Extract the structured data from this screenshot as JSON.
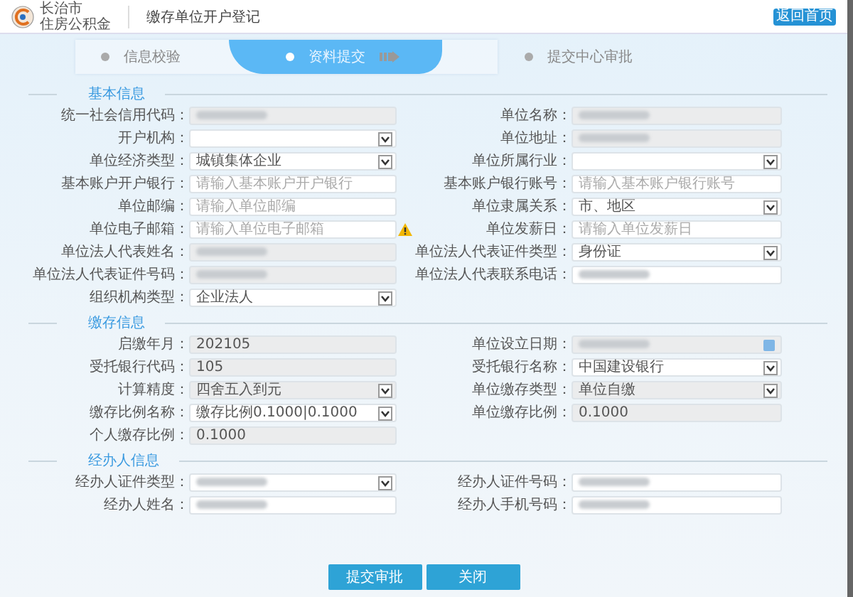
{
  "header": {
    "city": "长治市",
    "org": "住房公积金",
    "title": "缴存单位开户登记",
    "home_button": "返回首页"
  },
  "steps": [
    {
      "label": "信息校验",
      "selected": false
    },
    {
      "label": "资料提交",
      "selected": true
    },
    {
      "label": "提交中心审批",
      "selected": false
    }
  ],
  "sections": [
    {
      "title": "基本信息",
      "rows": [
        {
          "left": {
            "label": "统一社会信用代码：",
            "kind": "readonly",
            "redacted": true
          },
          "right": {
            "label": "单位名称：",
            "kind": "readonly",
            "redacted": true
          }
        },
        {
          "left": {
            "label": "开户机构：",
            "kind": "select"
          },
          "right": {
            "label": "单位地址：",
            "kind": "readonly",
            "redacted": true
          }
        },
        {
          "left": {
            "label": "单位经济类型：",
            "kind": "select",
            "value": "城镇集体企业"
          },
          "right": {
            "label": "单位所属行业：",
            "kind": "select"
          }
        },
        {
          "left": {
            "label": "基本账户开户银行：",
            "kind": "input",
            "placeholder": "请输入基本账户开户银行"
          },
          "right": {
            "label": "基本账户银行账号：",
            "kind": "input",
            "placeholder": "请输入基本账户银行账号"
          }
        },
        {
          "left": {
            "label": "单位邮编：",
            "kind": "input",
            "placeholder": "请输入单位邮编"
          },
          "right": {
            "label": "单位隶属关系：",
            "kind": "select",
            "value": "市、地区"
          }
        },
        {
          "left": {
            "label": "单位电子邮箱：",
            "kind": "input",
            "placeholder": "请输入单位电子邮箱",
            "warning": true
          },
          "right": {
            "label": "单位发薪日：",
            "kind": "input",
            "placeholder": "请输入单位发薪日"
          }
        },
        {
          "left": {
            "label": "单位法人代表姓名：",
            "kind": "readonly",
            "redacted": true
          },
          "right": {
            "label": "单位法人代表证件类型：",
            "kind": "select",
            "value": "身份证"
          }
        },
        {
          "left": {
            "label": "单位法人代表证件号码：",
            "kind": "readonly",
            "redacted": true
          },
          "right": {
            "label": "单位法人代表联系电话：",
            "kind": "input",
            "redacted": true
          }
        },
        {
          "left": {
            "label": "组织机构类型：",
            "kind": "select",
            "value": "企业法人"
          }
        }
      ]
    },
    {
      "title": "缴存信息",
      "rows": [
        {
          "left": {
            "label": "启缴年月：",
            "kind": "readonly",
            "value": "202105"
          },
          "right": {
            "label": "单位设立日期：",
            "kind": "date",
            "redacted": true
          }
        },
        {
          "left": {
            "label": "受托银行代码：",
            "kind": "readonly",
            "value": "105"
          },
          "right": {
            "label": "受托银行名称：",
            "kind": "select",
            "value": "中国建设银行"
          }
        },
        {
          "left": {
            "label": "计算精度：",
            "kind": "select",
            "value": "四舍五入到元",
            "disabled": true
          },
          "right": {
            "label": "单位缴存类型：",
            "kind": "select",
            "value": "单位自缴",
            "disabled": true
          }
        },
        {
          "left": {
            "label": "缴存比例名称：",
            "kind": "select",
            "value": "缴存比例0.1000|0.1000"
          },
          "right": {
            "label": "单位缴存比例：",
            "kind": "readonly",
            "value": "0.1000"
          }
        },
        {
          "left": {
            "label": "个人缴存比例：",
            "kind": "readonly",
            "value": "0.1000"
          }
        }
      ]
    },
    {
      "title": "经办人信息",
      "rows": [
        {
          "left": {
            "label": "经办人证件类型：",
            "kind": "select",
            "redacted": true
          },
          "right": {
            "label": "经办人证件号码：",
            "kind": "input",
            "redacted": true
          }
        },
        {
          "left": {
            "label": "经办人姓名：",
            "kind": "input",
            "redacted": true
          },
          "right": {
            "label": "经办人手机号码：",
            "kind": "input",
            "redacted": true
          }
        }
      ]
    }
  ],
  "buttons": [
    "提交审批",
    "关闭"
  ]
}
